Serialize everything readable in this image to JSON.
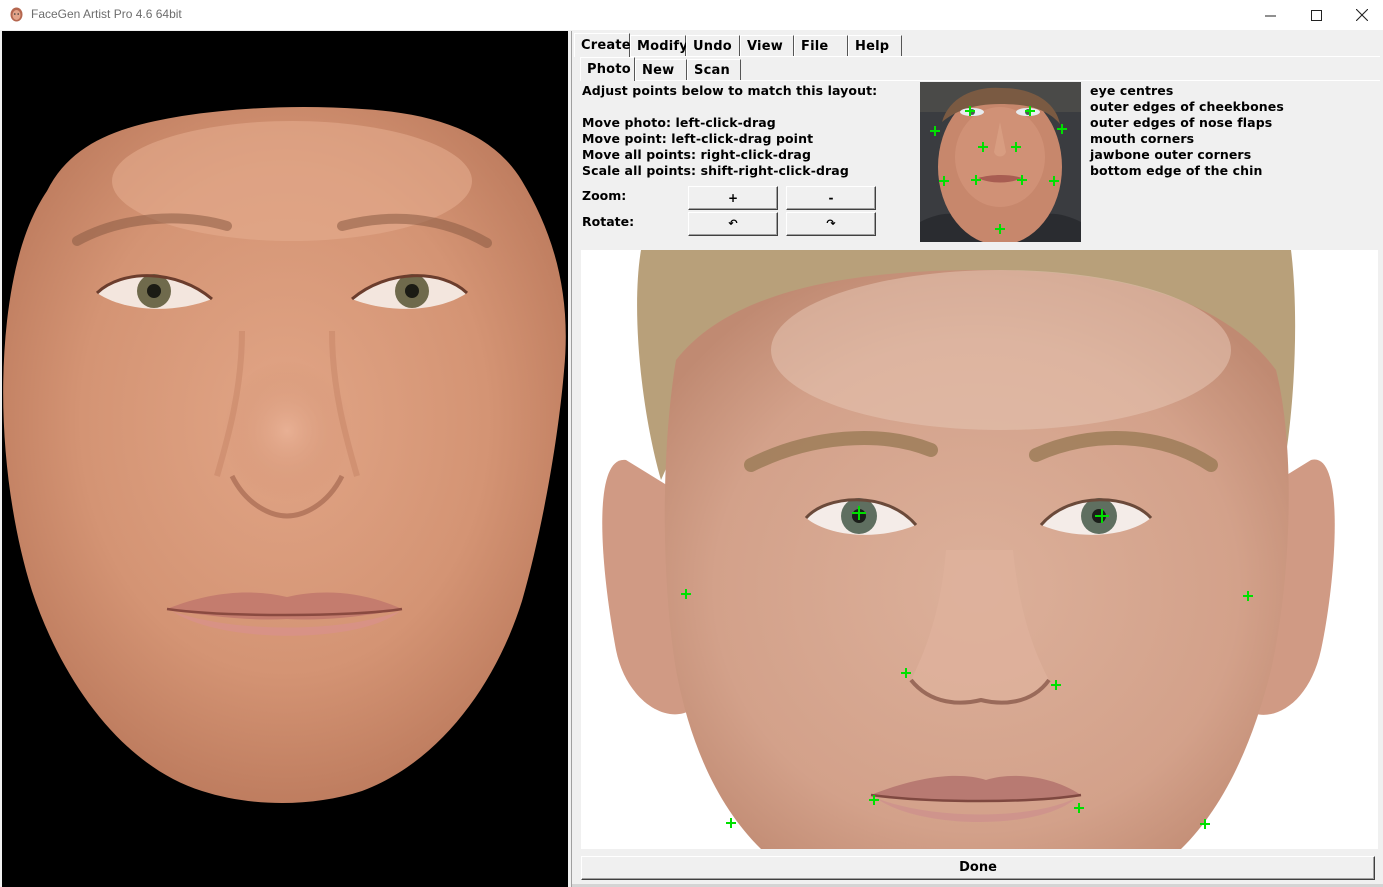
{
  "window": {
    "title": "FaceGen Artist Pro 4.6 64bit",
    "controls": {
      "minimize": "minimize-icon",
      "maximize": "maximize-icon",
      "close": "close-icon"
    }
  },
  "menu_tabs": [
    {
      "label": "Create",
      "active": true
    },
    {
      "label": "Modify"
    },
    {
      "label": "Undo"
    },
    {
      "label": "View"
    },
    {
      "label": "File"
    },
    {
      "label": "Help"
    }
  ],
  "sub_tabs": [
    {
      "label": "Photo",
      "active": true
    },
    {
      "label": "New"
    },
    {
      "label": "Scan"
    }
  ],
  "instructions": {
    "heading": "Adjust points below to match this layout:",
    "lines": [
      "Move photo: left-click-drag",
      "Move point: left-click-drag point",
      "Move all points: right-click-drag",
      "Scale all points: shift-right-click-drag"
    ]
  },
  "zoom": {
    "label": "Zoom:",
    "plus": "+",
    "minus": "-"
  },
  "rotate": {
    "label": "Rotate:",
    "ccw": "↶",
    "cw": "↷"
  },
  "legend": [
    "eye centres",
    "outer edges of cheekbones",
    "outer edges of nose flaps",
    "mouth corners",
    "jawbone outer corners",
    "bottom edge of the chin"
  ],
  "done_label": "Done",
  "colors": {
    "marker": "#00e000",
    "viewport_bg": "#000000",
    "panel_bg": "#f0f0f0"
  }
}
